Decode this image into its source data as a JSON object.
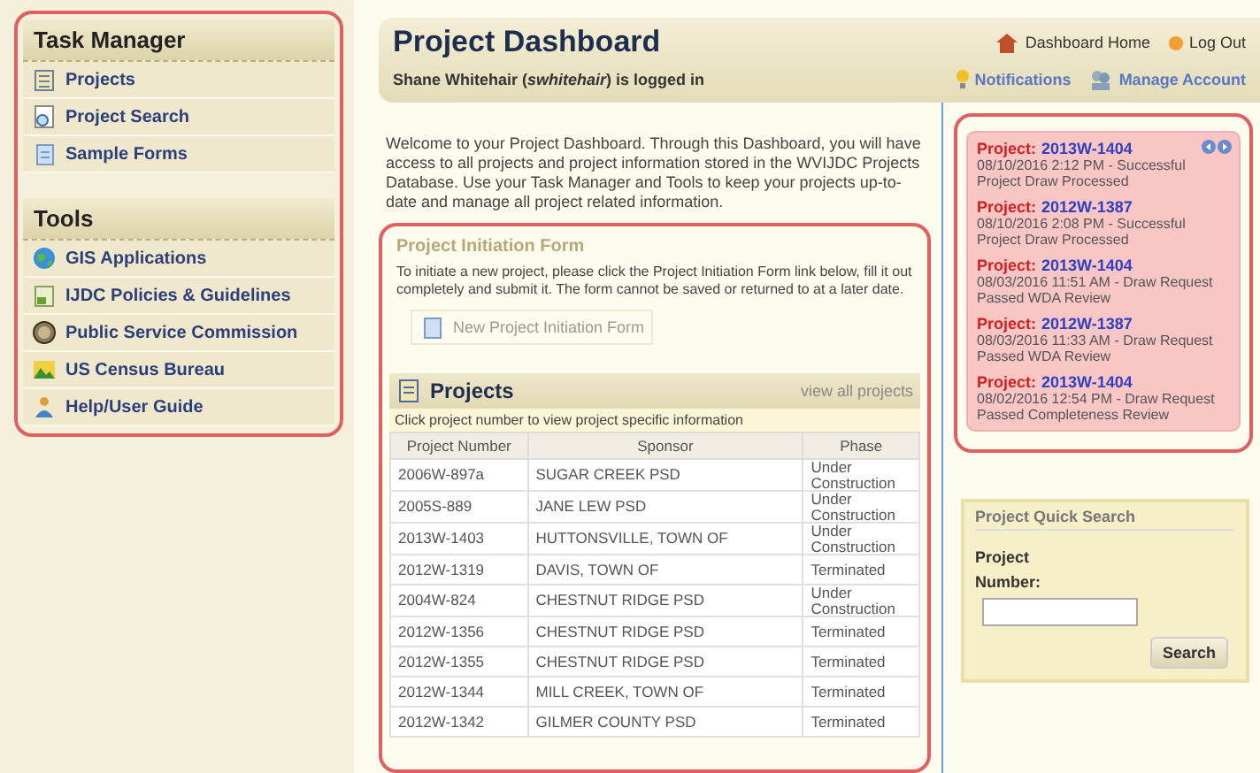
{
  "sidebar": {
    "sections": [
      {
        "title": "Task Manager",
        "items": [
          "Projects",
          "Project Search",
          "Sample Forms"
        ]
      },
      {
        "title": "Tools",
        "items": [
          "GIS Applications",
          "IJDC Policies & Guidelines",
          "Public Service Commission",
          "US Census Bureau",
          "Help/User Guide"
        ]
      }
    ]
  },
  "header": {
    "title": "Project Dashboard",
    "user": "Shane Whitehair (*swhitehair*) is logged in",
    "links": [
      "Dashboard Home",
      "Log Out"
    ],
    "account_links": [
      "Notifications",
      "Manage Account"
    ]
  },
  "welcome": "Welcome to your Project Dashboard. Through this Dashboard, you will have access to all projects and project information stored in the WVIJDC Projects Database. Use your Task Manager and Tools to keep your projects up-to-date and manage all project related information.",
  "initiation": {
    "title": "Project Initiation Form",
    "text": "To initiate a new project, please click the Project Initiation Form link below, fill it out completely and submit it. The form cannot be saved or returned to at a later date.",
    "link": "New Project Initiation Form"
  },
  "projects": {
    "title": "Projects",
    "view_all": "view all projects",
    "hint": "Click project number to view project specific information",
    "columns": [
      "Project Number",
      "Sponsor",
      "Phase"
    ],
    "rows": [
      [
        "2006W-897a",
        "SUGAR CREEK PSD",
        "Under Construction"
      ],
      [
        "2005S-889",
        "JANE LEW PSD",
        "Under Construction"
      ],
      [
        "2013W-1403",
        "HUTTONSVILLE, TOWN OF",
        "Under Construction"
      ],
      [
        "2012W-1319",
        "DAVIS, TOWN OF",
        "Terminated"
      ],
      [
        "2004W-824",
        "CHESTNUT RIDGE PSD",
        "Under Construction"
      ],
      [
        "2012W-1356",
        "CHESTNUT RIDGE PSD",
        "Terminated"
      ],
      [
        "2012W-1355",
        "CHESTNUT RIDGE PSD",
        "Terminated"
      ],
      [
        "2012W-1344",
        "MILL CREEK, TOWN OF",
        "Terminated"
      ],
      [
        "2012W-1342",
        "GILMER COUNTY PSD",
        "Terminated"
      ]
    ]
  },
  "notifications": [
    {
      "label": "Project:",
      "number": "2013W-1404",
      "text": "08/10/2016 2:12 PM - Successful Project Draw Processed"
    },
    {
      "label": "Project:",
      "number": "2012W-1387",
      "text": "08/10/2016 2:08 PM - Successful Project Draw Processed"
    },
    {
      "label": "Project:",
      "number": "2013W-1404",
      "text": "08/03/2016 11:51 AM - Draw Request Passed WDA Review"
    },
    {
      "label": "Project:",
      "number": "2012W-1387",
      "text": "08/03/2016 11:33 AM - Draw Request Passed WDA Review"
    },
    {
      "label": "Project:",
      "number": "2013W-1404",
      "text": "08/02/2016 12:54 PM - Draw Request Passed Completeness Review"
    }
  ],
  "quick_search": {
    "title": "Project Quick Search",
    "label": "Project Number:",
    "button": "Search"
  }
}
